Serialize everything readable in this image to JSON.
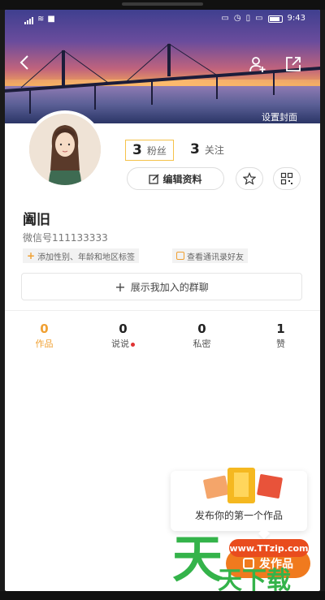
{
  "status_bar": {
    "time": "9:43"
  },
  "cover": {
    "set_cover_label": "设置封面"
  },
  "profile": {
    "fans_count": "3",
    "fans_label": "粉丝",
    "following_count": "3",
    "following_label": "关注",
    "edit_label": "编辑资料",
    "username": "阖旧",
    "wechat_id": "微信号111133333",
    "tags": [
      "添加性别、年龄和地区标签",
      "查看通讯录好友"
    ],
    "group_button_label": "展示我加入的群聊"
  },
  "tabs": [
    {
      "count": "0",
      "label": "作品"
    },
    {
      "count": "0",
      "label": "说说"
    },
    {
      "count": "0",
      "label": "私密"
    },
    {
      "count": "1",
      "label": "赞"
    }
  ],
  "publish": {
    "card_text": "发布你的第一个作品",
    "button_label": "发作品"
  },
  "watermark": {
    "brand_char": "天",
    "url": "www.TTzip.com",
    "sub_text": "天下载"
  },
  "colors": {
    "accent": "#f0a032",
    "publish_button": "#f07a1e",
    "badge_red": "#e03333",
    "watermark_green": "#34b34a"
  }
}
